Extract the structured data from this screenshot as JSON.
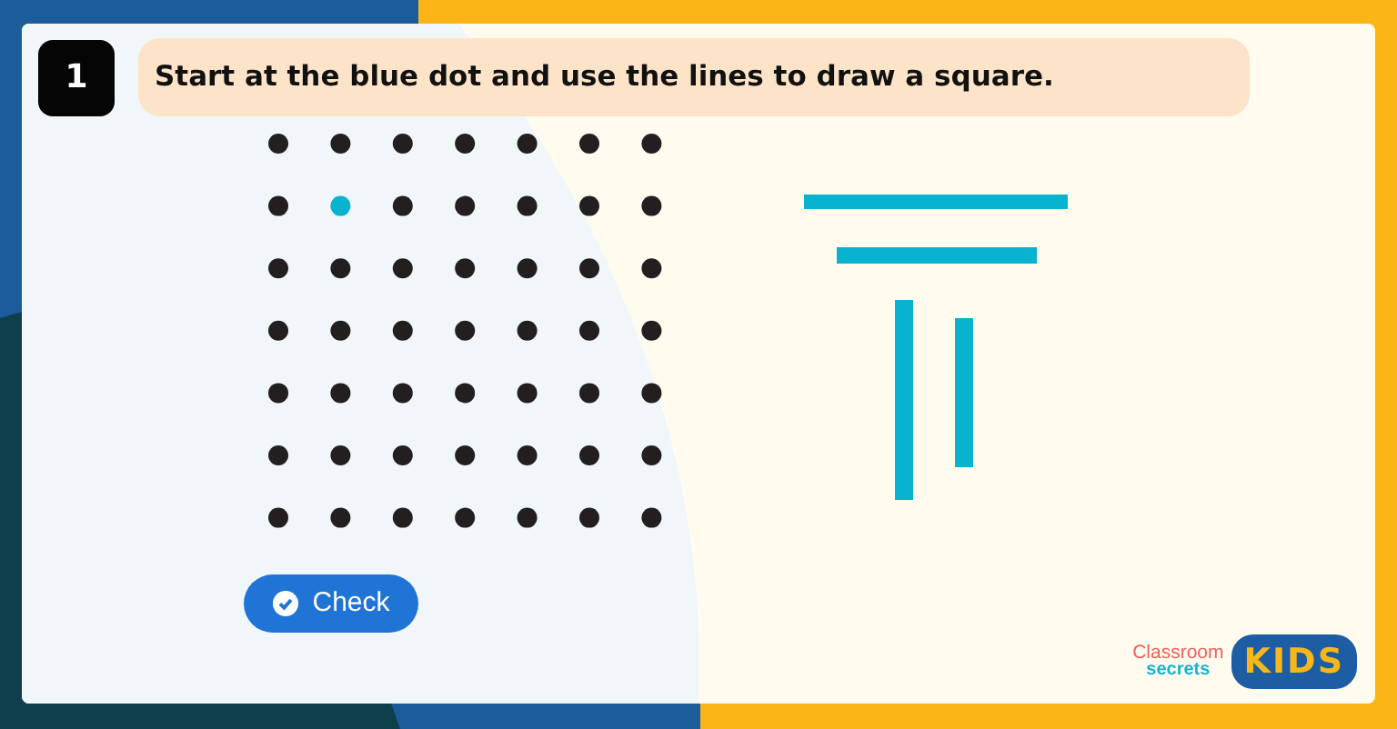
{
  "question": {
    "number": "1",
    "text": "Start at the blue dot and use the lines to draw a square."
  },
  "dot_grid": [
    [
      {
        "start": false
      },
      {
        "start": false
      },
      {
        "start": false
      },
      {
        "start": false
      },
      {
        "start": false
      },
      {
        "start": false
      },
      {
        "start": false
      }
    ],
    [
      {
        "start": false
      },
      {
        "start": true
      },
      {
        "start": false
      },
      {
        "start": false
      },
      {
        "start": false
      },
      {
        "start": false
      },
      {
        "start": false
      }
    ],
    [
      {
        "start": false
      },
      {
        "start": false
      },
      {
        "start": false
      },
      {
        "start": false
      },
      {
        "start": false
      },
      {
        "start": false
      },
      {
        "start": false
      }
    ],
    [
      {
        "start": false
      },
      {
        "start": false
      },
      {
        "start": false
      },
      {
        "start": false
      },
      {
        "start": false
      },
      {
        "start": false
      },
      {
        "start": false
      }
    ],
    [
      {
        "start": false
      },
      {
        "start": false
      },
      {
        "start": false
      },
      {
        "start": false
      },
      {
        "start": false
      },
      {
        "start": false
      },
      {
        "start": false
      }
    ],
    [
      {
        "start": false
      },
      {
        "start": false
      },
      {
        "start": false
      },
      {
        "start": false
      },
      {
        "start": false
      },
      {
        "start": false
      },
      {
        "start": false
      }
    ],
    [
      {
        "start": false
      },
      {
        "start": false
      },
      {
        "start": false
      },
      {
        "start": false
      },
      {
        "start": false
      },
      {
        "start": false
      },
      {
        "start": false
      }
    ]
  ],
  "check_button": {
    "label": "Check"
  },
  "logo": {
    "brand_line_1": "Classroom",
    "brand_line_2": "secrets",
    "badge": "KIDS"
  }
}
